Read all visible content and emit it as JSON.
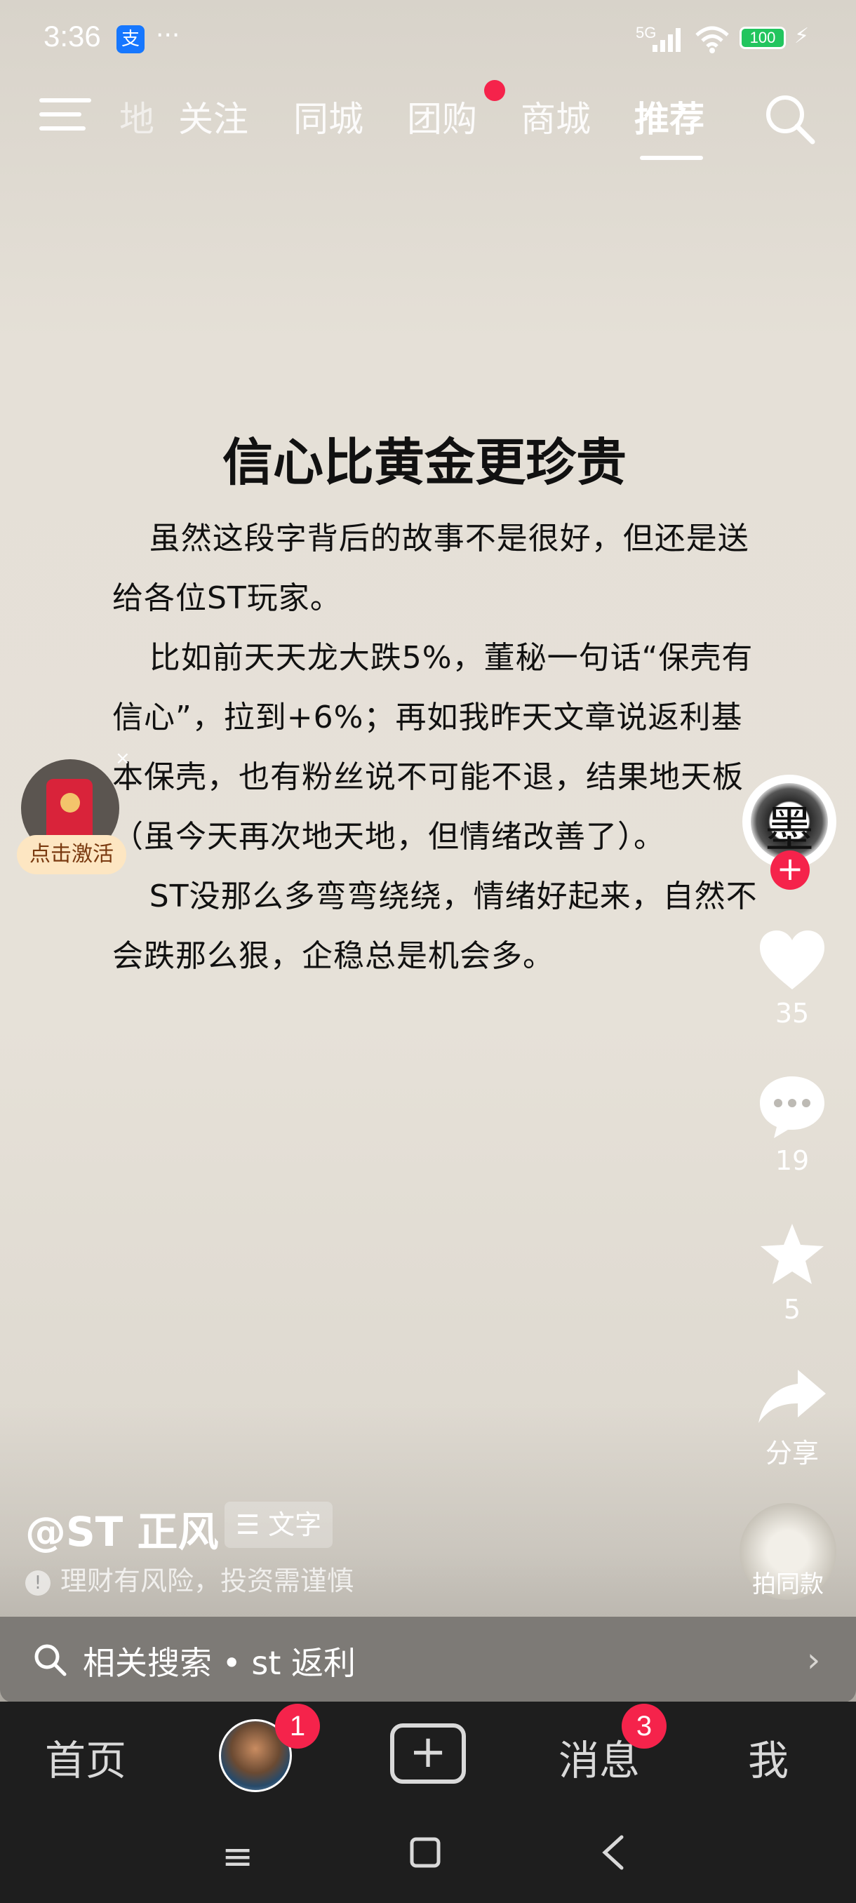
{
  "status_bar": {
    "time": "3:36",
    "alipay_glyph": "支",
    "more": "···",
    "network": "5G",
    "battery": "100",
    "charging_icon": "bolt-icon"
  },
  "top_nav": {
    "tabs": [
      {
        "label": "地",
        "state": "partial"
      },
      {
        "label": "关注",
        "state": "normal"
      },
      {
        "label": "同城",
        "state": "normal"
      },
      {
        "label": "团购",
        "state": "normal",
        "has_dot": true
      },
      {
        "label": "商城",
        "state": "normal"
      },
      {
        "label": "推荐",
        "state": "active"
      }
    ]
  },
  "article": {
    "title": "信心比黄金更珍贵",
    "paragraphs": [
      "虽然这段字背后的故事不是很好，但还是送给各位ST玩家。",
      "比如前天天龙大跌5%，董秘一句话“保壳有信心”，拉到+6%；再如我昨天文章说返利基本保壳，也有粉丝说不可能不退，结果地天板（虽今天再次地天地，但情绪改善了）。",
      "ST没那么多弯弯绕绕，情绪好起来，自然不会跌那么狠，企稳总是机会多。"
    ]
  },
  "red_packet": {
    "label": "点击激活",
    "close": "×"
  },
  "right_actions": {
    "avatar_glyph": "墨",
    "follow": "+",
    "like_count": "35",
    "comment_count": "19",
    "favorite_count": "5",
    "share_label": "分享",
    "remix_label": "拍同款"
  },
  "author": {
    "name": "@ST 正风",
    "tag": "文字",
    "risk_notice": "理财有风险，投资需谨慎"
  },
  "related_search": {
    "text": "相关搜索 • st 返利"
  },
  "bottom_nav": {
    "home": "首页",
    "friends_badge": "1",
    "messages": "消息",
    "messages_badge": "3",
    "me": "我"
  },
  "colors": {
    "accent_red": "#f5234b",
    "background": "#e2ddd4",
    "nav_bg": "#1e1e1e"
  }
}
